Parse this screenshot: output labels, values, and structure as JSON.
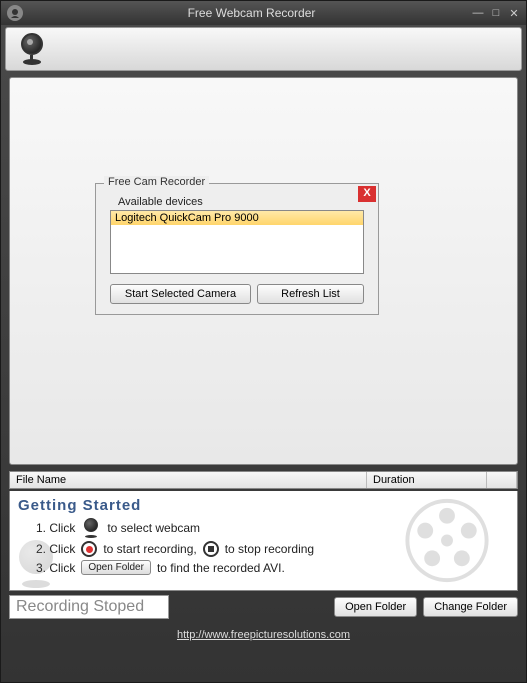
{
  "titlebar": {
    "title": "Free Webcam Recorder"
  },
  "dialog": {
    "legend": "Free Cam Recorder",
    "available_label": "Available devices",
    "close": "X",
    "devices": [
      "Logitech QuickCam Pro 9000"
    ],
    "start_btn": "Start Selected Camera",
    "refresh_btn": "Refresh List"
  },
  "table": {
    "col_name": "File Name",
    "col_duration": "Duration"
  },
  "help": {
    "title": "Getting  Started",
    "line1_a": "1. Click",
    "line1_b": "to select webcam",
    "line2_a": "2. Click",
    "line2_b": "to start recording,",
    "line2_c": "to stop recording",
    "line3_a": "3. Click",
    "open_folder_btn": "Open Folder",
    "line3_b": "to find the recorded AVI."
  },
  "status": "Recording Stoped",
  "buttons": {
    "open_folder": "Open Folder",
    "change_folder": "Change Folder"
  },
  "footer": {
    "url": "http://www.freepicturesolutions.com"
  }
}
